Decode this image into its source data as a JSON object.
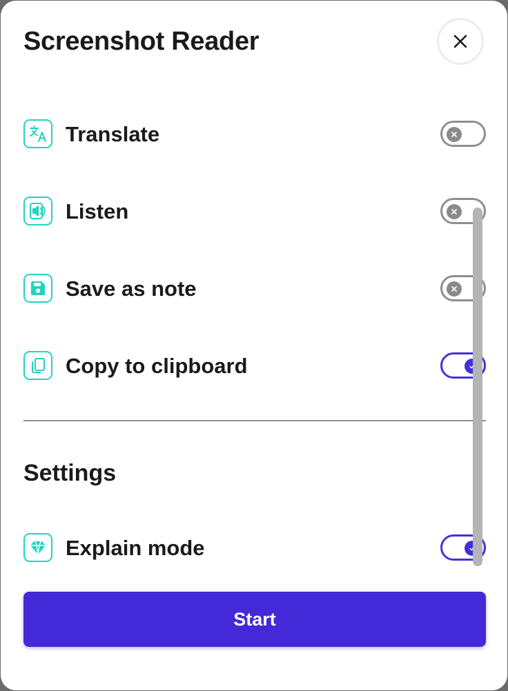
{
  "app": {
    "title": "Screenshot Reader"
  },
  "actions": [
    {
      "label": "Translate",
      "icon": "translate-icon",
      "enabled": false
    },
    {
      "label": "Listen",
      "icon": "speaker-icon",
      "enabled": false
    },
    {
      "label": "Save as note",
      "icon": "save-icon",
      "enabled": false
    },
    {
      "label": "Copy to clipboard",
      "icon": "copy-icon",
      "enabled": true
    }
  ],
  "settings": {
    "heading": "Settings",
    "items": [
      {
        "label": "Explain mode",
        "icon": "diamond-icon",
        "enabled": true
      }
    ]
  },
  "start_label": "Start",
  "colors": {
    "accent": "#4329d8",
    "icon_teal": "#23d3c0",
    "toggle_off": "#8e8e8e"
  }
}
